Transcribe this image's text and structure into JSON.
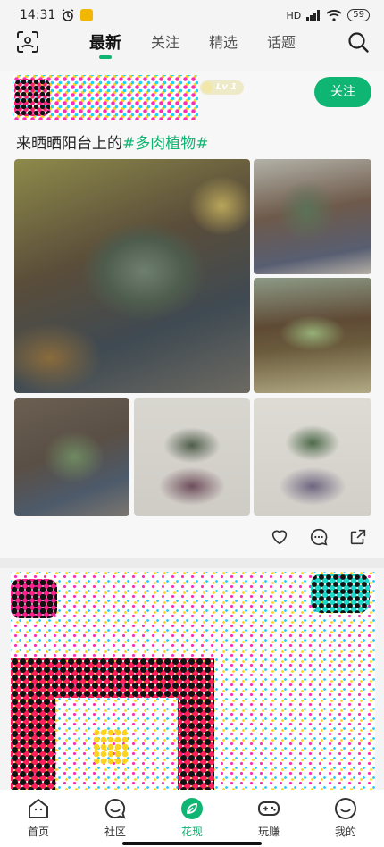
{
  "status_bar": {
    "time": "14:31",
    "signal": "HD",
    "battery": "59"
  },
  "top_nav": {
    "tabs": [
      {
        "label": "最新",
        "active": true
      },
      {
        "label": "关注",
        "active": false
      },
      {
        "label": "精选",
        "active": false
      },
      {
        "label": "话题",
        "active": false
      }
    ]
  },
  "post": {
    "level": "Lv 1",
    "follow_label": "关注",
    "text_prefix": "来晒晒阳台上的",
    "topic": "#多肉植物#"
  },
  "bottom_nav": {
    "items": [
      {
        "label": "首页",
        "icon": "home-icon",
        "active": false
      },
      {
        "label": "社区",
        "icon": "chat-icon",
        "active": false
      },
      {
        "label": "花现",
        "icon": "leaf-icon",
        "active": true
      },
      {
        "label": "玩赚",
        "icon": "gamepad-icon",
        "active": false
      },
      {
        "label": "我的",
        "icon": "profile-icon",
        "active": false
      }
    ]
  },
  "colors": {
    "accent": "#0fb572",
    "text": "#222222",
    "background": "#f4f4f4"
  }
}
